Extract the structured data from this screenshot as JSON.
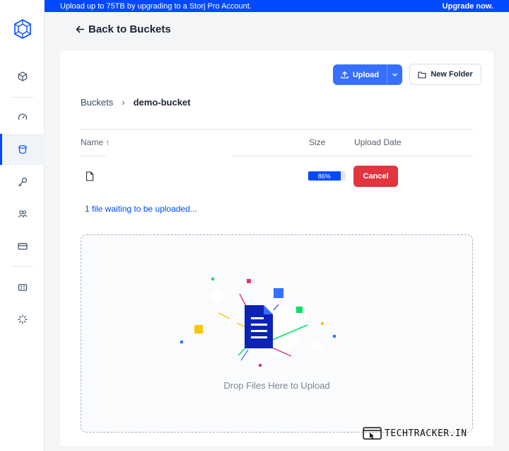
{
  "banner": {
    "message": "Upload up to 75TB by upgrading to a Storj Pro Account.",
    "action_label": "Upgrade now."
  },
  "sidebar": {
    "logo_icon": "storj-logo-icon",
    "items": [
      {
        "name": "projects",
        "icon": "cube-icon"
      },
      {
        "name": "dashboard",
        "icon": "gauge-icon"
      },
      {
        "name": "buckets",
        "icon": "bucket-icon",
        "active": true
      },
      {
        "name": "access",
        "icon": "key-icon"
      },
      {
        "name": "users",
        "icon": "users-icon"
      },
      {
        "name": "billing",
        "icon": "card-icon"
      },
      {
        "name": "resources",
        "icon": "doc-grid-icon"
      },
      {
        "name": "quick-start",
        "icon": "spinner-icon"
      }
    ],
    "accent_color": "#0149ff"
  },
  "back_link": {
    "label": "Back to Buckets"
  },
  "toolbar": {
    "upload_label": "Upload",
    "new_folder_label": "New Folder"
  },
  "breadcrumb": {
    "root": "Buckets",
    "separator": "›",
    "current": "demo-bucket"
  },
  "table": {
    "columns": {
      "name": "Name ↑",
      "size": "Size",
      "date": "Upload Date"
    },
    "rows": [
      {
        "name": "",
        "progress_percent": 86,
        "progress_label": "86%",
        "action_label": "Cancel"
      }
    ]
  },
  "upload_status": "1 file waiting to be uploaded...",
  "dropzone": {
    "label": "Drop Files Here to Upload"
  },
  "watermark": {
    "text": "TECHTRACKER.IN"
  },
  "colors": {
    "primary": "#376fff",
    "danger": "#e1353f",
    "link": "#0149ff"
  }
}
